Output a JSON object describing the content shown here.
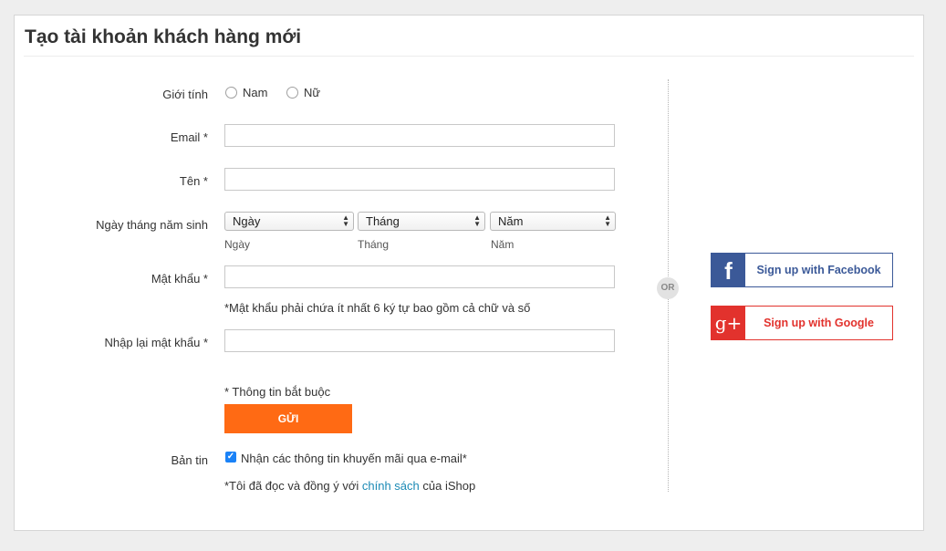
{
  "page": {
    "title": "Tạo tài khoản khách hàng mới"
  },
  "gender": {
    "label": "Giới tính",
    "options": [
      "Nam",
      "Nữ"
    ]
  },
  "email": {
    "label": "Email *",
    "value": ""
  },
  "name": {
    "label": "Tên *",
    "value": ""
  },
  "birthdate": {
    "label": "Ngày tháng năm sinh",
    "day": {
      "selected": "Ngày",
      "caption": "Ngày"
    },
    "month": {
      "selected": "Tháng",
      "caption": "Tháng"
    },
    "year": {
      "selected": "Năm",
      "caption": "Năm"
    }
  },
  "password": {
    "label": "Mật khẩu *",
    "value": "",
    "hint": "*Mật khẩu phải chứa ít nhất 6 ký tự bao gồm cả chữ và số"
  },
  "password_confirm": {
    "label": "Nhập lại mật khẩu *",
    "value": ""
  },
  "required_note": "* Thông tin bắt buộc",
  "submit_label": "GỬI",
  "newsletter": {
    "label": "Bản tin",
    "checkbox_label": "Nhận các thông tin khuyến mãi qua e-mail*",
    "checked": true
  },
  "terms": {
    "prefix": "*Tôi đã đọc và đồng ý với ",
    "link": "chính sách",
    "suffix": " của iShop"
  },
  "or_text": "OR",
  "social": {
    "facebook": {
      "label": "Sign up with Facebook",
      "icon": "facebook-icon",
      "color": "#3b5998"
    },
    "google": {
      "label": "Sign up with Google",
      "icon": "google-plus-icon",
      "color": "#e2322d"
    }
  },
  "colors": {
    "accent": "#ff6a14",
    "link": "#1b8ab5"
  }
}
